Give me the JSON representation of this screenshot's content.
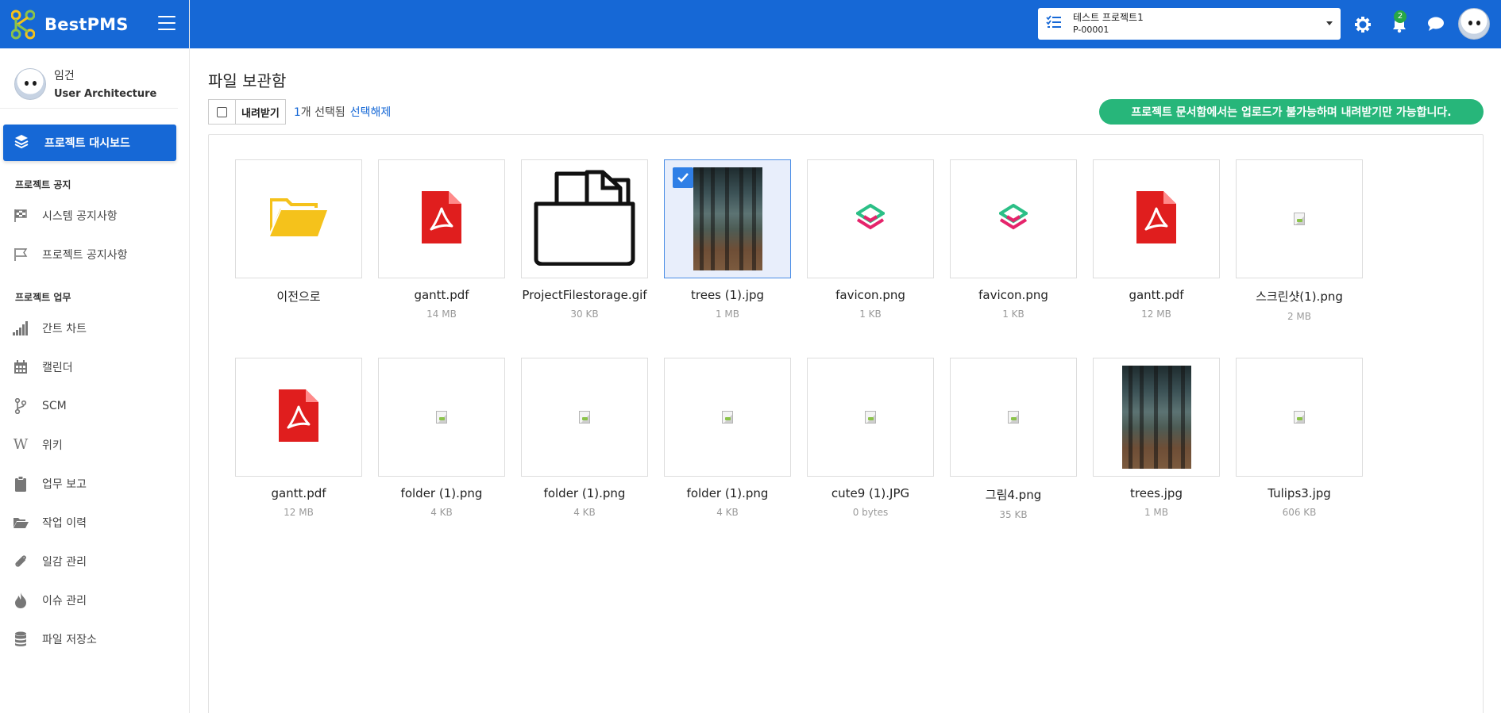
{
  "app": {
    "name": "BestPMS"
  },
  "user": {
    "name": "임건",
    "role": "User Architecture"
  },
  "sidebar": {
    "active": "프로젝트 대시보드",
    "sections": [
      {
        "title": "프로젝트 공지",
        "items": [
          "시스템 공지사항",
          "프로젝트 공지사항"
        ]
      },
      {
        "title": "프로젝트 업무",
        "items": [
          "간트 차트",
          "캘린더",
          "SCM",
          "위키",
          "업무 보고",
          "작업 이력",
          "일감 관리",
          "이슈 관리",
          "파일 저장소"
        ]
      }
    ]
  },
  "header": {
    "project_name": "테스트 프로젝트1",
    "project_code": "P-00001",
    "notification_count": "2"
  },
  "main": {
    "title": "파일 보관함",
    "download_label": "내려받기",
    "selected_count": "1",
    "selected_suffix": "개 선택됨",
    "clear_label": "선택해제",
    "notice": "프로젝트 문서함에서는 업로드가 불가능하며 내려받기만 가능합니다."
  },
  "files": [
    {
      "name": "이전으로",
      "size": "",
      "icon": "folder-open-icon"
    },
    {
      "name": "gantt.pdf",
      "size": "14 MB",
      "icon": "pdf-icon"
    },
    {
      "name": "ProjectFilestorage.gif",
      "size": "30 KB",
      "icon": "folder-document-icon"
    },
    {
      "name": "trees (1).jpg",
      "size": "1 MB",
      "icon": "image-trees",
      "selected": true
    },
    {
      "name": "favicon.png",
      "size": "1 KB",
      "icon": "favicon-logo"
    },
    {
      "name": "favicon.png",
      "size": "1 KB",
      "icon": "favicon-logo"
    },
    {
      "name": "gantt.pdf",
      "size": "12 MB",
      "icon": "pdf-icon"
    },
    {
      "name": "스크린샷(1).png",
      "size": "2 MB",
      "icon": "broken-image-icon"
    },
    {
      "name": "gantt.pdf",
      "size": "12 MB",
      "icon": "pdf-icon"
    },
    {
      "name": "folder (1).png",
      "size": "4 KB",
      "icon": "broken-image-icon"
    },
    {
      "name": "folder (1).png",
      "size": "4 KB",
      "icon": "broken-image-icon"
    },
    {
      "name": "folder (1).png",
      "size": "4 KB",
      "icon": "broken-image-icon"
    },
    {
      "name": "cute9 (1).JPG",
      "size": "0 bytes",
      "icon": "broken-image-icon"
    },
    {
      "name": "그림4.png",
      "size": "35 KB",
      "icon": "broken-image-icon"
    },
    {
      "name": "trees.jpg",
      "size": "1 MB",
      "icon": "image-trees"
    },
    {
      "name": "Tulips3.jpg",
      "size": "606 KB",
      "icon": "broken-image-icon"
    }
  ],
  "colors": {
    "primary": "#1668d6",
    "notice": "#27b67a",
    "pdf": "#e01e1e",
    "folder": "#f5c21b"
  }
}
